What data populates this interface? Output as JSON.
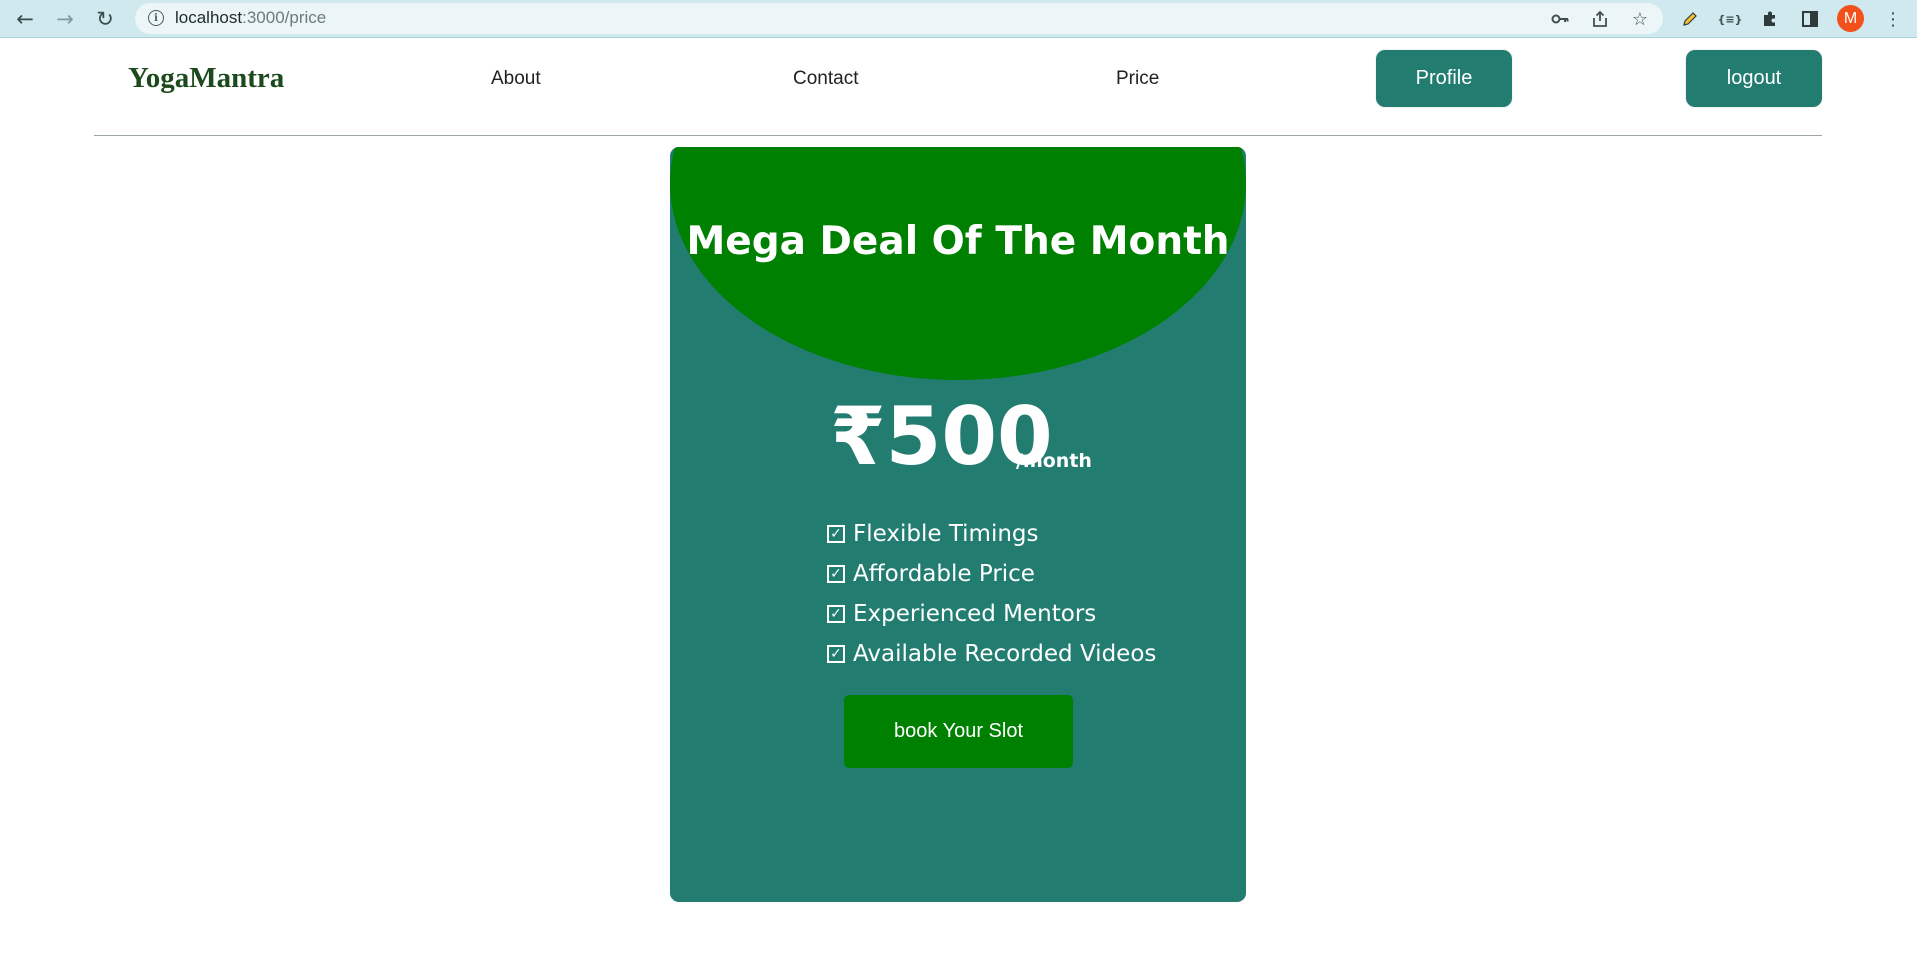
{
  "browser": {
    "url_host": "localhost",
    "url_path": ":3000/price",
    "avatar_initial": "M"
  },
  "header": {
    "logo": "YogaMantra",
    "nav": {
      "about": "About",
      "contact": "Contact",
      "price": "Price"
    },
    "profile_label": "Profile",
    "logout_label": "logout"
  },
  "card": {
    "title": "Mega Deal Of The Month",
    "price": "₹500",
    "per": "/month",
    "features": [
      "Flexible Timings",
      "Affordable Price",
      "Experienced Mentors",
      "Available Recorded Videos"
    ],
    "button_label": "book Your Slot"
  },
  "colors": {
    "card_bg": "#227d70",
    "card_head": "#008000",
    "header_button": "#227d70",
    "logo": "#1c4a1c"
  }
}
